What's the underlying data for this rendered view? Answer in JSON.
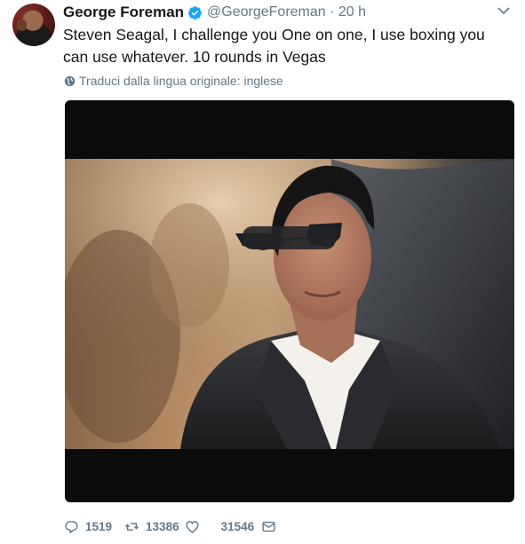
{
  "tweet": {
    "author_name": "George Foreman",
    "handle_time": "@GeorgeForeman · 20 h",
    "text": "Steven Seagal, I challenge you One on one, I use boxing you can use whatever. 10 rounds in Vegas",
    "translate_label": "Traduci dalla lingua originale: inglese"
  },
  "actions": {
    "reply_count": "1519",
    "retweet_count": "13386",
    "like_count": "31546"
  },
  "colors": {
    "verified": "#1da1f2",
    "muted": "#657786",
    "text": "#14171a"
  },
  "icons": [
    "avatar",
    "verified-badge-icon",
    "chevron-down-icon",
    "globe-icon",
    "reply-icon",
    "retweet-icon",
    "like-icon",
    "message-icon"
  ]
}
